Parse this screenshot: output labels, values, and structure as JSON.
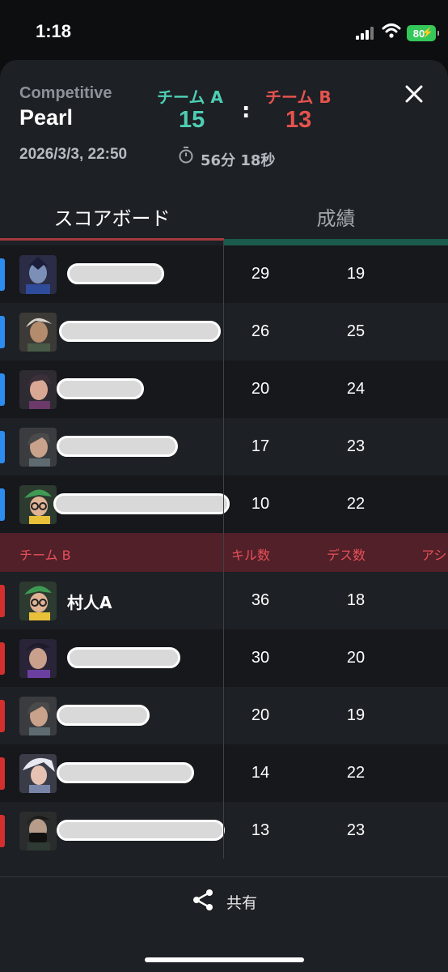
{
  "status": {
    "time": "1:18",
    "battery": "80"
  },
  "match": {
    "mode": "Competitive",
    "map": "Pearl",
    "datetime": "2026/3/3, 22:50",
    "duration": "56分 18秒",
    "teamA": {
      "label": "チーム A",
      "score": "15"
    },
    "teamB": {
      "label": "チーム B",
      "score": "13"
    },
    "separator": ":"
  },
  "tabs": [
    {
      "label": "スコアボード",
      "active": true
    },
    {
      "label": "成績",
      "active": false
    }
  ],
  "teamA_players": [
    {
      "name": "",
      "kills": "29",
      "deaths": "19"
    },
    {
      "name": "",
      "kills": "26",
      "deaths": "25"
    },
    {
      "name": "",
      "kills": "20",
      "deaths": "24"
    },
    {
      "name": "",
      "kills": "17",
      "deaths": "23"
    },
    {
      "name": "",
      "kills": "10",
      "deaths": "22"
    }
  ],
  "teamB_header": {
    "team": "チーム B",
    "kills": "キル数",
    "deaths": "デス数",
    "assists": "アシ"
  },
  "teamB_players": [
    {
      "name": "村人A",
      "kills": "36",
      "deaths": "18"
    },
    {
      "name": "",
      "kills": "30",
      "deaths": "20"
    },
    {
      "name": "",
      "kills": "20",
      "deaths": "19"
    },
    {
      "name": "",
      "kills": "14",
      "deaths": "22"
    },
    {
      "name": "",
      "kills": "13",
      "deaths": "23"
    }
  ],
  "footer": {
    "share_label": "共有"
  },
  "colors": {
    "teamA": "#4ecdb3",
    "teamB": "#e5534f",
    "sideA": "#2d8cf0",
    "sideB": "#d32f2f"
  }
}
